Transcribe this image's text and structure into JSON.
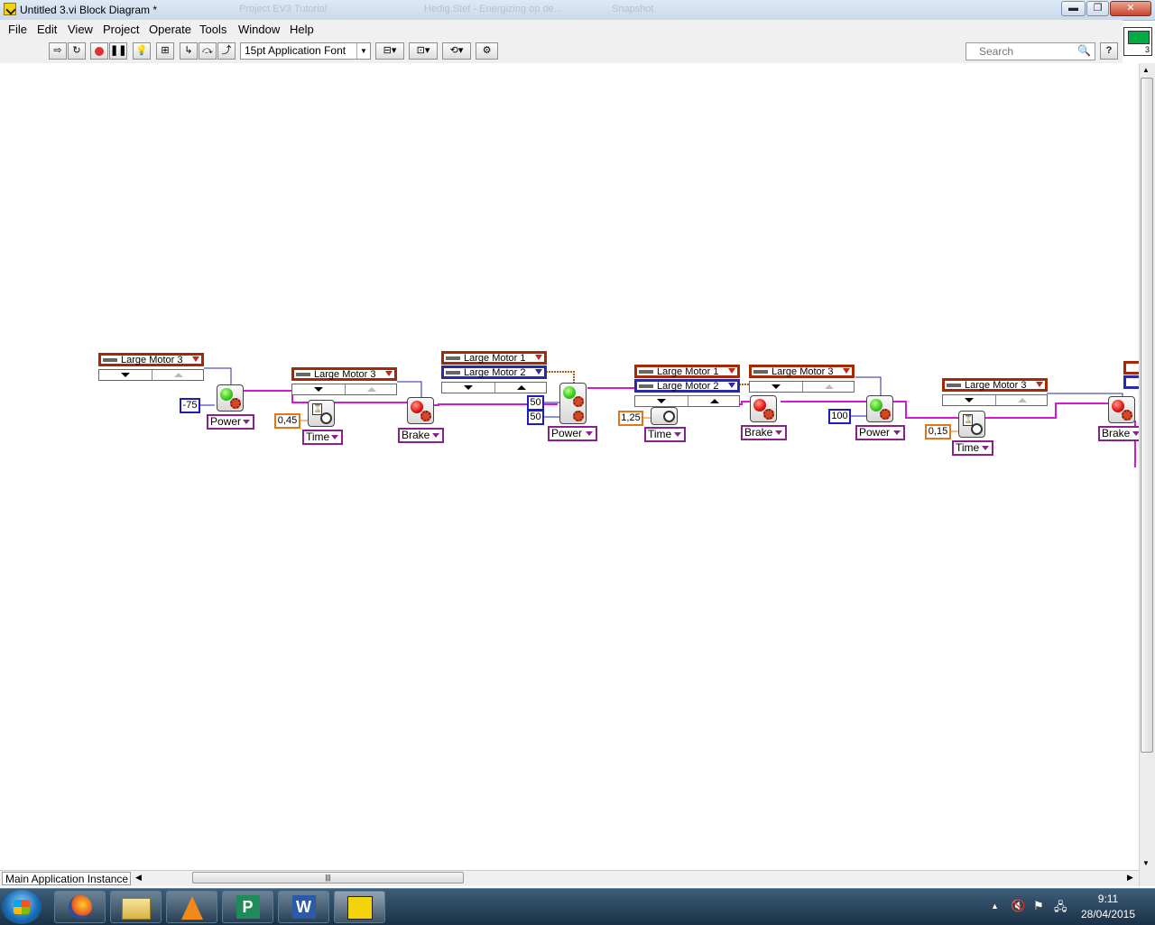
{
  "window": {
    "title": "Untitled 3.vi Block Diagram *",
    "background_tabs": [
      "Project EV3 Tutorial",
      "Hedig Stef - Energizing op de...",
      "Snapshot"
    ],
    "controls": {
      "minimize": "▬",
      "maximize": "❐",
      "close": "✕"
    }
  },
  "menu": [
    "File",
    "Edit",
    "View",
    "Project",
    "Operate",
    "Tools",
    "Window",
    "Help"
  ],
  "toolbar": {
    "font": "15pt Application Font",
    "search_placeholder": "Search",
    "icons": [
      "run-arrow-icon",
      "run-continuous-icon",
      "abort-icon",
      "pause-icon",
      "highlight-execution-icon",
      "retain-wire-values-icon",
      "step-into-icon",
      "step-over-icon",
      "step-out-icon",
      "align-objects-icon",
      "distribute-objects-icon",
      "reorder-icon",
      "clean-up-diagram-icon",
      "help-icon"
    ],
    "vi_icon_label": "3"
  },
  "diagram": {
    "selectors": [
      {
        "label": "Large Motor 3"
      },
      {
        "label": "Large Motor 3"
      },
      {
        "label": "Large Motor 1"
      },
      {
        "label": "Large Motor 2"
      },
      {
        "label": "Large Motor 1"
      },
      {
        "label": "Large Motor 2"
      },
      {
        "label": "Large Motor 3"
      },
      {
        "label": "Large Motor 3"
      }
    ],
    "constants": [
      "-75",
      "0,45",
      "50",
      "50",
      "1,25",
      "100",
      "0,15"
    ],
    "modes": [
      "Power",
      "Time",
      "Brake",
      "Power",
      "Time",
      "Brake",
      "Power",
      "Time",
      "Brake"
    ]
  },
  "status": {
    "context": "Main Application Instance"
  },
  "taskbar": {
    "apps": [
      "firefox-icon",
      "file-explorer-icon",
      "vlc-icon",
      "publisher-icon",
      "word-icon",
      "labview-icon"
    ],
    "time": "9:11",
    "date": "28/04/2015"
  },
  "colors": {
    "motor_wire": "#d21ad0",
    "selector_border": "#a42a06",
    "numeric_border": "#1c1cc2",
    "double_border": "#e2771a",
    "mode_border": "#8a1f8e"
  }
}
